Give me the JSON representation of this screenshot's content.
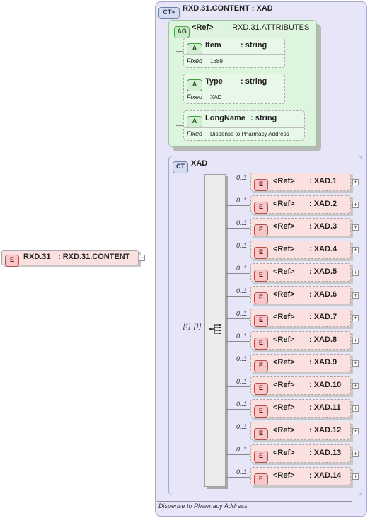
{
  "root_element": {
    "badge": "E",
    "name": "RXD.31",
    "type": ": RXD.31.CONTENT",
    "collapse": "−"
  },
  "complex_type": {
    "badge": "CT+",
    "title": "RXD.31.CONTENT : XAD"
  },
  "attribute_group": {
    "badge": "AG",
    "ref": "<Ref>",
    "type": ": RXD.31.ATTRIBUTES",
    "attributes": [
      {
        "badge": "A",
        "name": "Item",
        "type": ": string",
        "fixed_label": "Fixed",
        "fixed_value": "1689"
      },
      {
        "badge": "A",
        "name": "Type",
        "type": ": string",
        "fixed_label": "Fixed",
        "fixed_value": "XAD"
      },
      {
        "badge": "A",
        "name": "LongName",
        "type": ": string",
        "fixed_label": "Fixed",
        "fixed_value": "Dispense to Pharmacy Address"
      }
    ]
  },
  "inner_type": {
    "badge": "CT",
    "name": "XAD"
  },
  "sequence": {
    "multiplicity": "[1]..[1]"
  },
  "elements": [
    {
      "mult": "0..1",
      "badge": "E",
      "ref": "<Ref>",
      "type": ": XAD.1",
      "expand": "+"
    },
    {
      "mult": "0..1",
      "badge": "E",
      "ref": "<Ref>",
      "type": ": XAD.2",
      "expand": "+"
    },
    {
      "mult": "0..1",
      "badge": "E",
      "ref": "<Ref>",
      "type": ": XAD.3",
      "expand": "+"
    },
    {
      "mult": "0..1",
      "badge": "E",
      "ref": "<Ref>",
      "type": ": XAD.4",
      "expand": "+"
    },
    {
      "mult": "0..1",
      "badge": "E",
      "ref": "<Ref>",
      "type": ": XAD.5",
      "expand": "+"
    },
    {
      "mult": "0..1",
      "badge": "E",
      "ref": "<Ref>",
      "type": ": XAD.6",
      "expand": "+"
    },
    {
      "mult": "0..1",
      "badge": "E",
      "ref": "<Ref>",
      "type": ": XAD.7",
      "expand": "+"
    },
    {
      "mult": "0..1",
      "badge": "E",
      "ref": "<Ref>",
      "type": ": XAD.8",
      "expand": "+"
    },
    {
      "mult": "0..1",
      "badge": "E",
      "ref": "<Ref>",
      "type": ": XAD.9",
      "expand": "+"
    },
    {
      "mult": "0..1",
      "badge": "E",
      "ref": "<Ref>",
      "type": ": XAD.10",
      "expand": "+"
    },
    {
      "mult": "0..1",
      "badge": "E",
      "ref": "<Ref>",
      "type": ": XAD.11",
      "expand": "+"
    },
    {
      "mult": "0..1",
      "badge": "E",
      "ref": "<Ref>",
      "type": ": XAD.12",
      "expand": "+"
    },
    {
      "mult": "0..1",
      "badge": "E",
      "ref": "<Ref>",
      "type": ": XAD.13",
      "expand": "+"
    },
    {
      "mult": "0..1",
      "badge": "E",
      "ref": "<Ref>",
      "type": ": XAD.14",
      "expand": "+"
    }
  ],
  "annotation": "Dispense to Pharmacy Address"
}
